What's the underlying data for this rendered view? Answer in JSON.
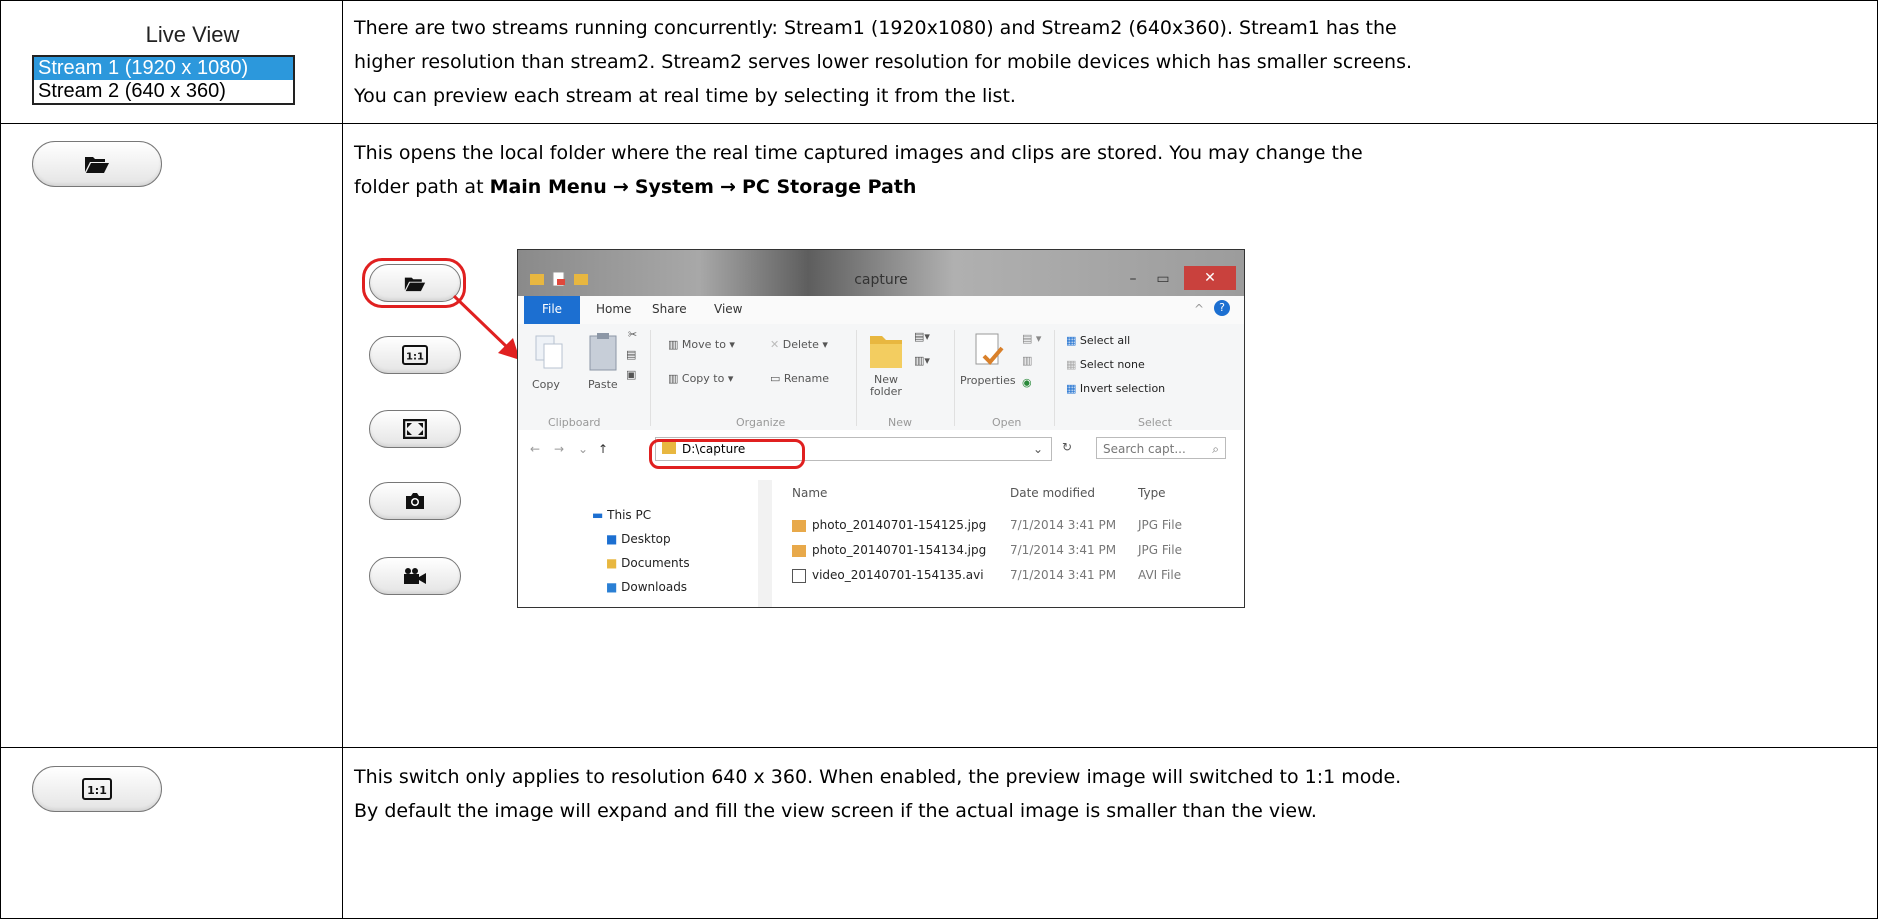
{
  "rows": [
    {
      "widget": {
        "title": "Live View",
        "options": [
          "Stream 1 (1920 x 1080)",
          "Stream 2 (640 x 360)"
        ],
        "selected": "Stream 1 (1920 x 1080)"
      },
      "lines": [
        "There are two streams running concurrently: Stream1 (1920x1080) and Stream2 (640x360). Stream1 has the",
        "higher resolution than stream2. Stream2 serves lower resolution for mobile devices which has smaller screens.",
        "You can preview each stream at real time by selecting it from the list."
      ]
    },
    {
      "button_icon": "folder-icon",
      "line1": "This opens the local folder where the real time captured images and clips are stored. You may change the",
      "line2_prefix": "folder path at ",
      "path": [
        "Main Menu",
        "System",
        "PC Storage Path"
      ],
      "arrow": "→",
      "side_buttons": [
        "folder-icon",
        "one-to-one-icon",
        "fullscreen-icon",
        "camera-icon",
        "video-camera-icon"
      ],
      "explorer": {
        "title": "capture",
        "tabs": [
          "File",
          "Home",
          "Share",
          "View"
        ],
        "ribbon": {
          "copy": "Copy",
          "paste": "Paste",
          "move_to": "Move to",
          "delete": "Delete",
          "copy_to": "Copy to",
          "rename": "Rename",
          "new_folder": "New\nfolder",
          "properties": "Properties",
          "select_all": "Select all",
          "select_none": "Select none",
          "invert_selection": "Invert selection",
          "groups": [
            "Clipboard",
            "Organize",
            "New",
            "Open",
            "Select"
          ]
        },
        "address": "D:\\capture",
        "search_placeholder": "Search capt...",
        "columns": [
          "Name",
          "Date modified",
          "Type"
        ],
        "tree": [
          "This PC",
          "Desktop",
          "Documents",
          "Downloads"
        ],
        "files": [
          {
            "name": "photo_20140701-154125.jpg",
            "date": "7/1/2014 3:41 PM",
            "type": "JPG File"
          },
          {
            "name": "photo_20140701-154134.jpg",
            "date": "7/1/2014 3:41 PM",
            "type": "JPG File"
          },
          {
            "name": "video_20140701-154135.avi",
            "date": "7/1/2014 3:41 PM",
            "type": "AVI File"
          }
        ]
      }
    },
    {
      "button_icon": "one-to-one-icon",
      "button_label": "1:1",
      "lines": [
        "This switch only applies to resolution 640 x 360. When enabled, the preview image will switched to 1:1 mode.",
        "By default the image will expand and fill the view screen if the actual image is smaller than the view."
      ]
    }
  ],
  "colors": {
    "selection_blue": "#2c98dc",
    "highlight_red": "#e02020",
    "file_tab_blue": "#1c6fd1",
    "close_red": "#c9413d"
  }
}
